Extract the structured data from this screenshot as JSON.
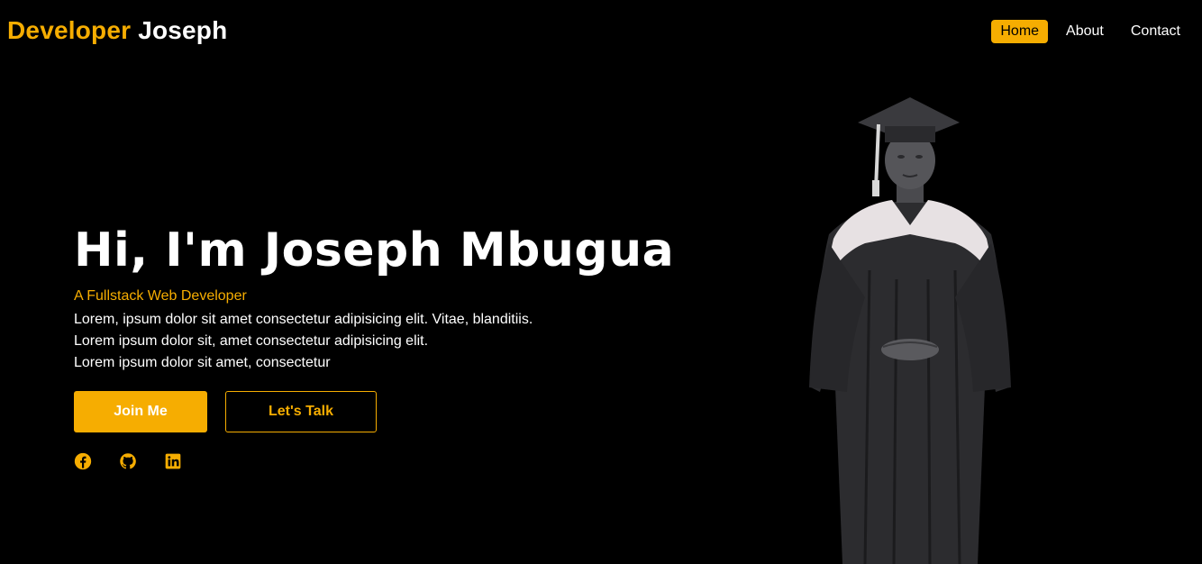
{
  "header": {
    "logo_accent": "Developer",
    "logo_name": "Joseph",
    "nav": [
      {
        "label": "Home",
        "active": true
      },
      {
        "label": "About",
        "active": false
      },
      {
        "label": "Contact",
        "active": false
      }
    ]
  },
  "hero": {
    "headline": "Hi, I'm Joseph Mbugua",
    "subtitle": "A Fullstack Web Developer",
    "description_lines": [
      "Lorem, ipsum dolor sit amet consectetur adipisicing elit. Vitae, blanditiis.",
      "Lorem ipsum dolor sit, amet consectetur adipisicing elit.",
      "Lorem ipsum dolor sit amet, consectetur"
    ],
    "primary_button": "Join Me",
    "secondary_button": "Let's Talk"
  },
  "socials": [
    {
      "icon": "facebook-icon"
    },
    {
      "icon": "github-icon"
    },
    {
      "icon": "linkedin-icon"
    }
  ],
  "colors": {
    "accent": "#f6ad01",
    "background": "#000000",
    "text": "#ffffff"
  }
}
